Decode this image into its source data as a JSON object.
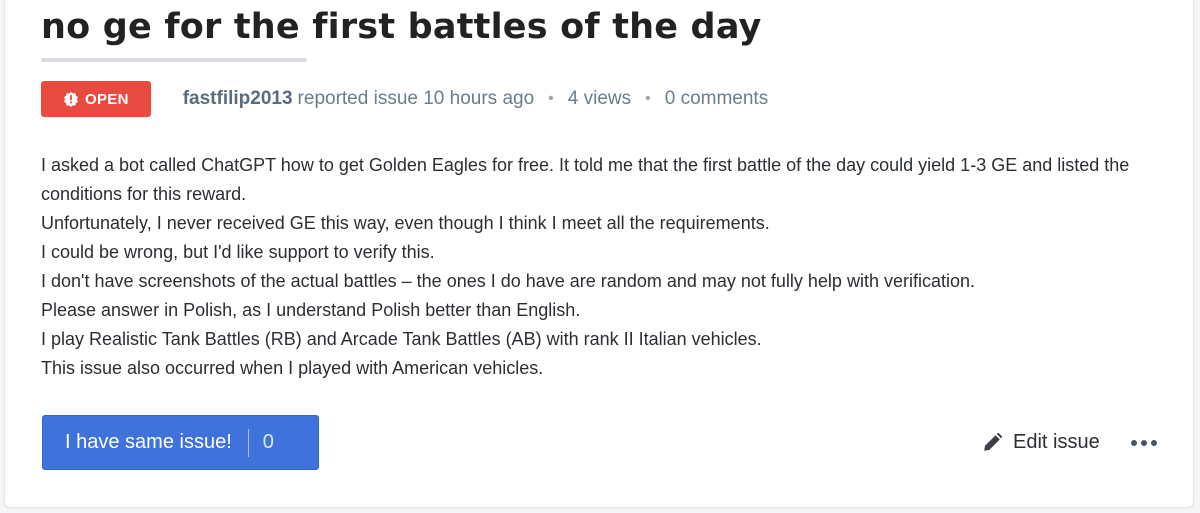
{
  "issue": {
    "title": "no ge for the first battles of the day",
    "status": "OPEN",
    "status_color": "#e94a3f",
    "author": "fastfilip2013",
    "reported_text": "reported issue 10 hours ago",
    "views": "4 views",
    "comments": "0 comments",
    "separator": "•",
    "body_lines": [
      "I asked a bot called ChatGPT how to get Golden Eagles for free. It told me that the first battle of the day could yield 1-3 GE and listed the conditions for this reward.",
      "Unfortunately, I never received GE this way, even though I think I meet all the requirements.",
      "I could be wrong, but I'd like support to verify this.",
      "I don't have screenshots of the actual battles – the ones I do have are random and may not fully help with verification.",
      "Please answer in Polish, as I understand Polish better than English.",
      "I play Realistic Tank Battles (RB) and Arcade Tank Battles (AB) with rank II Italian vehicles.",
      "This issue also occurred when I played with American vehicles."
    ]
  },
  "actions": {
    "same_issue_label": "I have same issue!",
    "same_issue_count": "0",
    "same_issue_color": "#3f73db",
    "edit_label": "Edit issue",
    "edit_icon": "pencil-icon",
    "more_icon": "more-dots-icon",
    "status_icon": "alert-icon"
  }
}
